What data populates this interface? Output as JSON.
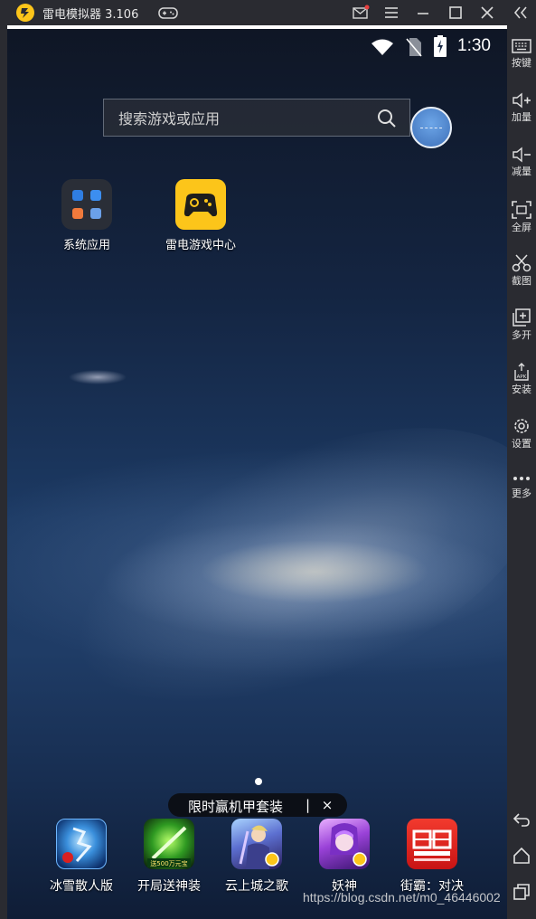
{
  "window": {
    "title": "雷电模拟器 3.106",
    "icons": [
      "leidian-logo-icon",
      "gamepad-icon",
      "mail-icon",
      "menu-icon",
      "minimize-icon",
      "maximize-icon",
      "close-icon"
    ]
  },
  "status_bar": {
    "time": "1:30",
    "icons": [
      "wifi-icon",
      "no-sim-icon",
      "battery-charging-icon"
    ]
  },
  "search": {
    "placeholder": "搜索游戏或应用",
    "icon": "search-icon"
  },
  "desktop_apps": [
    {
      "label": "系统应用",
      "icon": "folder-icon"
    },
    {
      "label": "雷电游戏中心",
      "icon": "game-center-icon"
    }
  ],
  "promo": {
    "text": "限时赢机甲套装",
    "separator": "|",
    "close": "×"
  },
  "dock": [
    {
      "label": "冰雪散人版",
      "icon": "bingxue-game-icon"
    },
    {
      "label": "开局送神装",
      "icon": "sword-game-icon"
    },
    {
      "label": "云上城之歌",
      "icon": "yunshang-game-icon"
    },
    {
      "label": "妖神",
      "icon": "yaoshen-game-icon"
    },
    {
      "label": "街霸：对决",
      "icon": "jieba-game-icon"
    }
  ],
  "watermark": "https://blog.csdn.net/m0_46446002",
  "sidebar": {
    "items": [
      {
        "label": "按键",
        "icon": "keyboard-icon"
      },
      {
        "label": "加量",
        "icon": "volume-up-icon"
      },
      {
        "label": "减量",
        "icon": "volume-down-icon"
      },
      {
        "label": "全屏",
        "icon": "fullscreen-icon"
      },
      {
        "label": "截图",
        "icon": "scissors-icon"
      },
      {
        "label": "多开",
        "icon": "multi-open-icon"
      },
      {
        "label": "安装",
        "icon": "apk-install-icon"
      },
      {
        "label": "设置",
        "icon": "gear-icon"
      },
      {
        "label": "更多",
        "icon": "more-icon"
      }
    ],
    "nav": [
      "back-icon",
      "home-icon",
      "recents-icon"
    ]
  },
  "colors": {
    "chrome": "#2a2b31",
    "leidian_yellow": "#fcc51a",
    "wallpaper_deep": "#142542",
    "text_light": "#ffffff"
  }
}
